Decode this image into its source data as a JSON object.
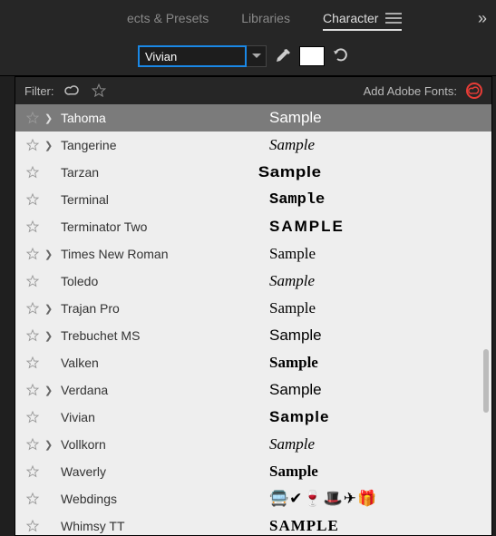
{
  "tabs": {
    "effects": "ects & Presets",
    "libraries": "Libraries",
    "character": "Character"
  },
  "more_glyph": "»",
  "font_input_value": "Vivian",
  "filter": {
    "label": "Filter:",
    "add_label": "Add Adobe Fonts:"
  },
  "fonts": [
    {
      "name": "Tahoma",
      "expandable": true,
      "sample": "Sample",
      "cls": "smp-tahoma",
      "selected": true
    },
    {
      "name": "Tangerine",
      "expandable": true,
      "sample": "Sample",
      "cls": "smp-tangerine",
      "selected": false
    },
    {
      "name": "Tarzan",
      "expandable": false,
      "sample": "Sample",
      "cls": "smp-tarzan",
      "selected": false
    },
    {
      "name": "Terminal",
      "expandable": false,
      "sample": "Sample",
      "cls": "smp-terminal",
      "selected": false
    },
    {
      "name": "Terminator Two",
      "expandable": false,
      "sample": "SAMPLE",
      "cls": "smp-term2",
      "selected": false
    },
    {
      "name": "Times New Roman",
      "expandable": true,
      "sample": "Sample",
      "cls": "smp-times",
      "selected": false
    },
    {
      "name": "Toledo",
      "expandable": false,
      "sample": "Sample",
      "cls": "smp-toledo",
      "selected": false
    },
    {
      "name": "Trajan Pro",
      "expandable": true,
      "sample": "Sample",
      "cls": "smp-trajan",
      "selected": false
    },
    {
      "name": "Trebuchet MS",
      "expandable": true,
      "sample": "Sample",
      "cls": "smp-trebuchet",
      "selected": false
    },
    {
      "name": "Valken",
      "expandable": false,
      "sample": "Sample",
      "cls": "smp-valken",
      "selected": false
    },
    {
      "name": "Verdana",
      "expandable": true,
      "sample": "Sample",
      "cls": "smp-verdana",
      "selected": false
    },
    {
      "name": "Vivian",
      "expandable": false,
      "sample": "Sample",
      "cls": "smp-vivian",
      "selected": false
    },
    {
      "name": "Vollkorn",
      "expandable": true,
      "sample": "Sample",
      "cls": "smp-vollkorn",
      "selected": false
    },
    {
      "name": "Waverly",
      "expandable": false,
      "sample": "Sample",
      "cls": "smp-waverly",
      "selected": false
    },
    {
      "name": "Webdings",
      "expandable": false,
      "sample": "🚍✔🍷🎩✈🎁",
      "cls": "smp-webdings",
      "selected": false
    },
    {
      "name": "Whimsy TT",
      "expandable": false,
      "sample": "SAMPLE",
      "cls": "smp-whimsy",
      "selected": false
    }
  ]
}
